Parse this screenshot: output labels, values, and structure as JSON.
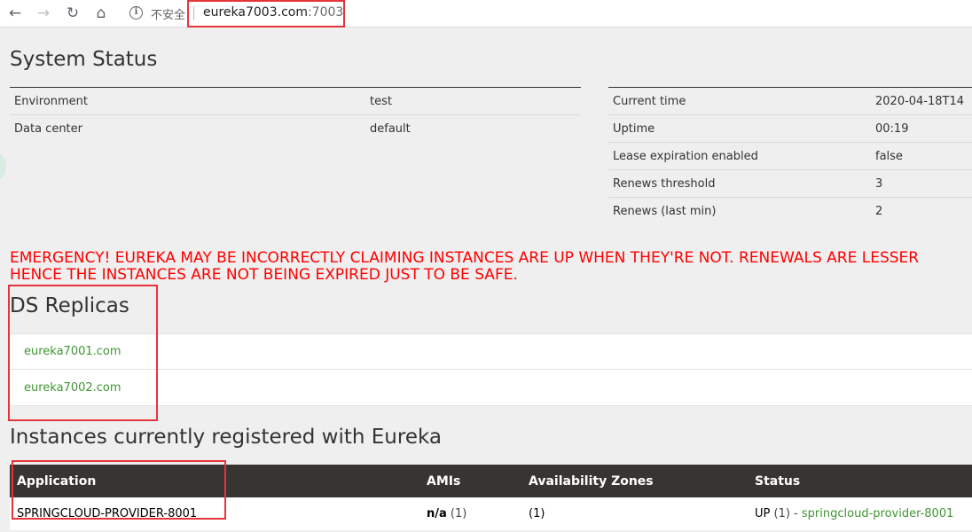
{
  "browser": {
    "back_icon": "←",
    "forward_icon": "→",
    "reload_icon": "↻",
    "home_icon": "⌂",
    "info_icon": "i",
    "insecure_label": "不安全",
    "url_host": "eureka7003.com",
    "url_port": ":7003"
  },
  "system_status": {
    "title": "System Status",
    "left_rows": [
      {
        "key": "Environment",
        "value": "test"
      },
      {
        "key": "Data center",
        "value": "default"
      }
    ],
    "right_rows": [
      {
        "key": "Current time",
        "value": "2020-04-18T14"
      },
      {
        "key": "Uptime",
        "value": "00:19"
      },
      {
        "key": "Lease expiration enabled",
        "value": "false"
      },
      {
        "key": "Renews threshold",
        "value": "3"
      },
      {
        "key": "Renews (last min)",
        "value": "2"
      }
    ]
  },
  "emergency": {
    "line1": "EMERGENCY! EUREKA MAY BE INCORRECTLY CLAIMING INSTANCES ARE UP WHEN THEY'RE NOT. RENEWALS ARE LESSER",
    "line2": "HENCE THE INSTANCES ARE NOT BEING EXPIRED JUST TO BE SAFE."
  },
  "replicas": {
    "title": "DS Replicas",
    "items": [
      "eureka7001.com",
      "eureka7002.com"
    ]
  },
  "instances": {
    "title": "Instances currently registered with Eureka",
    "headers": {
      "application": "Application",
      "amis": "AMIs",
      "zones": "Availability Zones",
      "status": "Status"
    },
    "rows": [
      {
        "application": "SPRINGCLOUD-PROVIDER-8001",
        "amis": "n/a",
        "amis_count": "(1)",
        "zones": "(1)",
        "status": "UP",
        "status_count": "(1) -",
        "status_link": "springcloud-provider-8001"
      }
    ]
  },
  "colors": {
    "highlight": "#e5353b",
    "emergency": "#ff0000",
    "link": "#3f9632",
    "header_bg": "#383431"
  }
}
